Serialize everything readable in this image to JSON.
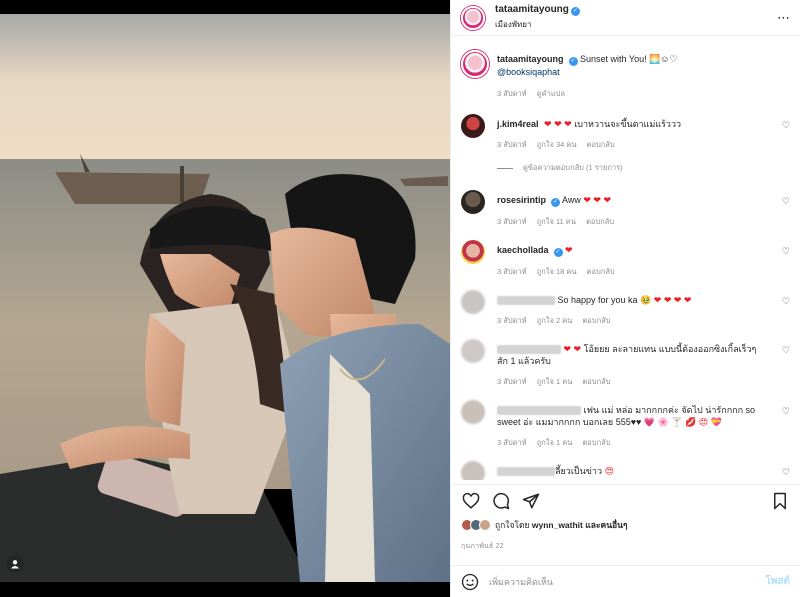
{
  "header": {
    "username": "tataamitayoung",
    "location": "เมืองพัทยา",
    "more_icon": "⋯"
  },
  "caption": {
    "username": "tataamitayoung",
    "text": "Sunset with You! 🌅☺︎♡",
    "mention": "@booksiqaphat",
    "time": "3 สัปดาห์",
    "translate": "ดูคำแปล"
  },
  "comments": [
    {
      "username": "j.kim4real",
      "hearts": "❤ ❤ ❤",
      "text": "เบาหวานจะขึ้นตาแม่แร้ววว",
      "time": "3 สัปดาห์",
      "likes": "ถูกใจ 34 คน",
      "reply": "ตอบกลับ",
      "view_replies": "ดูข้อความตอบกลับ (1 รายการ)"
    },
    {
      "username": "rosesirintip",
      "text": "Aww",
      "hearts": "❤ ❤ ❤",
      "time": "3 สัปดาห์",
      "likes": "ถูกใจ 11 คน",
      "reply": "ตอบกลับ"
    },
    {
      "username": "kaechollada",
      "hearts": "❤",
      "time": "3 สัปดาห์",
      "likes": "ถูกใจ 18 คน",
      "reply": "ตอบกลับ"
    },
    {
      "text": "So happy for you ka",
      "emoji": "🥹 ❤ ❤ ❤ ❤",
      "time": "3 สัปดาห์",
      "likes": "ถูกใจ 2 คน",
      "reply": "ตอบกลับ"
    },
    {
      "hearts": "❤ ❤",
      "text_line1": "โอ้ยยย ละลายแทน แบบนี้ต้องออกซิงเกิ้ลเร็วๆ",
      "text_line2": "สัก 1 แล้วครับ",
      "time": "3 สัปดาห์",
      "likes": "ถูกใจ 1 คน",
      "reply": "ตอบกลับ"
    },
    {
      "text_line1": "เฟน แม่ หล่อ มากกกกค่ะ จัดไป น่ารักกกก so",
      "text_line2": "sweet อ่ะ แมมากกกก บอกเลย 555♥♥",
      "emoji": "💗 🌸 🍸 💋 😍 💝",
      "time": "3 สัปดาห์",
      "likes": "ถูกใจ 1 คน",
      "reply": "ตอบกลับ"
    },
    {
      "text": "ลี้ยวเป็นข่าว",
      "emoji": "😍"
    }
  ],
  "actions": {
    "like_icon": "heart-icon",
    "comment_icon": "comment-icon",
    "share_icon": "share-icon",
    "save_icon": "bookmark-icon"
  },
  "likes": {
    "prefix": "ถูกใจโดย",
    "user": "wynn_wathit",
    "suffix": "และคนอื่นๆ"
  },
  "date": "กุมภาพันธ์ 22",
  "composer": {
    "placeholder": "เพิ่มความคิดเห็น",
    "post": "โพสต์"
  },
  "colors": {
    "verified": "#3897f0",
    "mention": "#00376b",
    "heart": "#ed1c24",
    "post_disabled": "#b2dffc"
  }
}
